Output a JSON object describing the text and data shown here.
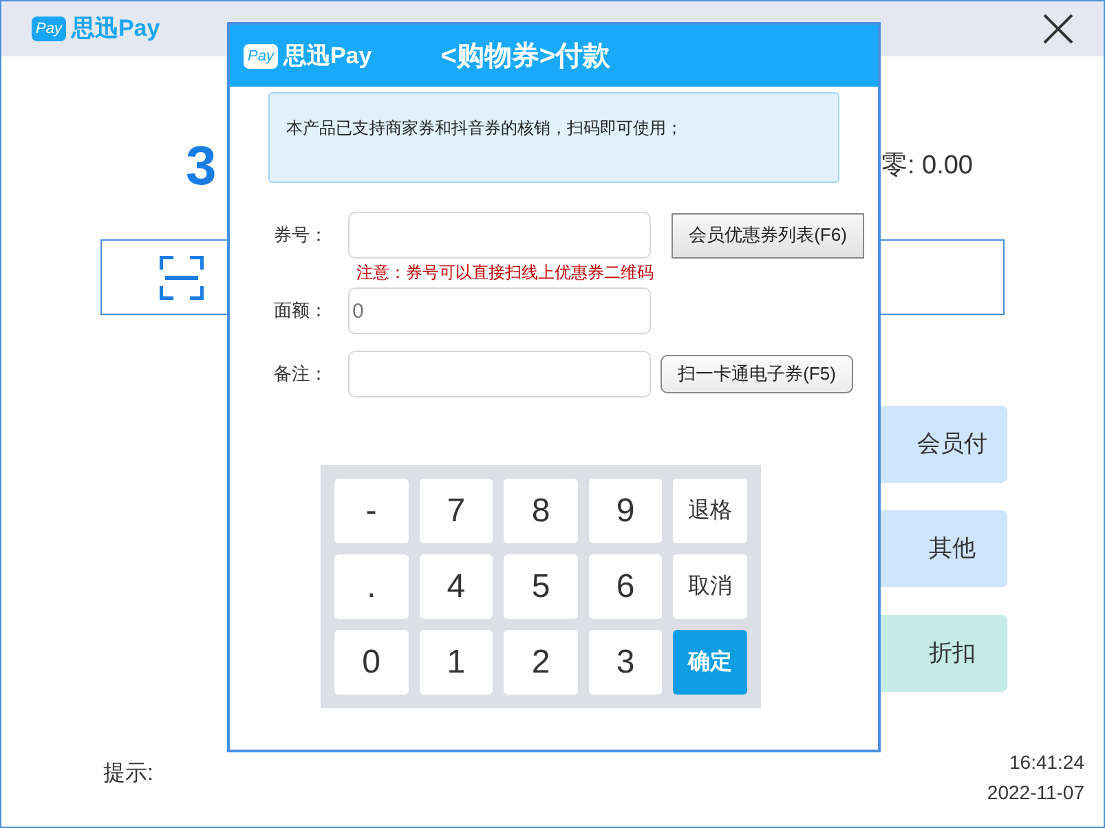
{
  "app": {
    "badge": "Pay",
    "logo": "思迅Pay"
  },
  "amount": "3",
  "change": "零: 0.00",
  "pay_buttons": [
    {
      "label": "会员付",
      "color": "#cfe5fd"
    },
    {
      "label": "其他",
      "color": "#cfe5fd"
    },
    {
      "label": "折扣",
      "color": "#c4ebe4"
    }
  ],
  "hint_label": "提示:",
  "time": "16:41:24",
  "date": "2022-11-07",
  "dialog": {
    "badge": "Pay",
    "logo": "思迅Pay",
    "title": "<购物券>付款",
    "notice": "本产品已支持商家券和抖音券的核销，扫码即可使用；",
    "fields": [
      {
        "label": "券号："
      },
      {
        "label": "面额：",
        "value": "0"
      },
      {
        "label": "备注："
      }
    ],
    "note": "注意：券号可以直接扫线上优惠券二维码",
    "coupon_list_button": "会员优惠券列表(F6)",
    "ecard_button": "扫一卡通电子券(F5)",
    "keys": [
      {
        "label": "-",
        "kind": "key"
      },
      {
        "label": "7",
        "kind": "key"
      },
      {
        "label": "8",
        "kind": "key"
      },
      {
        "label": "9",
        "kind": "key"
      },
      {
        "label": "退格",
        "kind": "word"
      },
      {
        "label": ".",
        "kind": "key"
      },
      {
        "label": "4",
        "kind": "key"
      },
      {
        "label": "5",
        "kind": "key"
      },
      {
        "label": "6",
        "kind": "key"
      },
      {
        "label": "取消",
        "kind": "word"
      },
      {
        "label": "0",
        "kind": "key"
      },
      {
        "label": "1",
        "kind": "key"
      },
      {
        "label": "2",
        "kind": "key"
      },
      {
        "label": "3",
        "kind": "key"
      },
      {
        "label": "确定",
        "kind": "primary"
      }
    ]
  }
}
